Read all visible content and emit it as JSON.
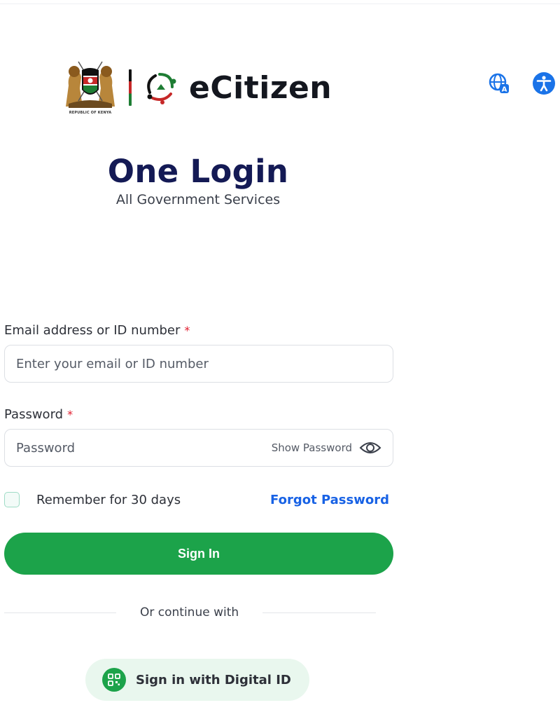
{
  "branding": {
    "coat_of_arms_caption": "REPUBLIC OF KENYA",
    "brand_name": "eCitizen"
  },
  "top_icons": [
    "globe-translate-icon",
    "accessibility-icon"
  ],
  "hero": {
    "title": "One Login",
    "subtitle": "All Government Services"
  },
  "form": {
    "email": {
      "label": "Email address or ID number",
      "required_mark": "*",
      "placeholder": "Enter your email or ID number",
      "value": ""
    },
    "password": {
      "label": "Password",
      "required_mark": "*",
      "placeholder": "Password",
      "value": "",
      "show_label": "Show Password"
    },
    "remember": {
      "label": "Remember for 30 days",
      "checked": false
    },
    "forgot_label": "Forgot Password",
    "submit_label": "Sign In"
  },
  "alt_login": {
    "divider_text": "Or continue with",
    "digital_id_label": "Sign in with Digital ID"
  },
  "colors": {
    "brand_navy": "#141a55",
    "primary_green": "#1ca34a",
    "link_blue": "#1862e5",
    "required_red": "#e11d2e",
    "icon_blue": "#1a73e8"
  }
}
